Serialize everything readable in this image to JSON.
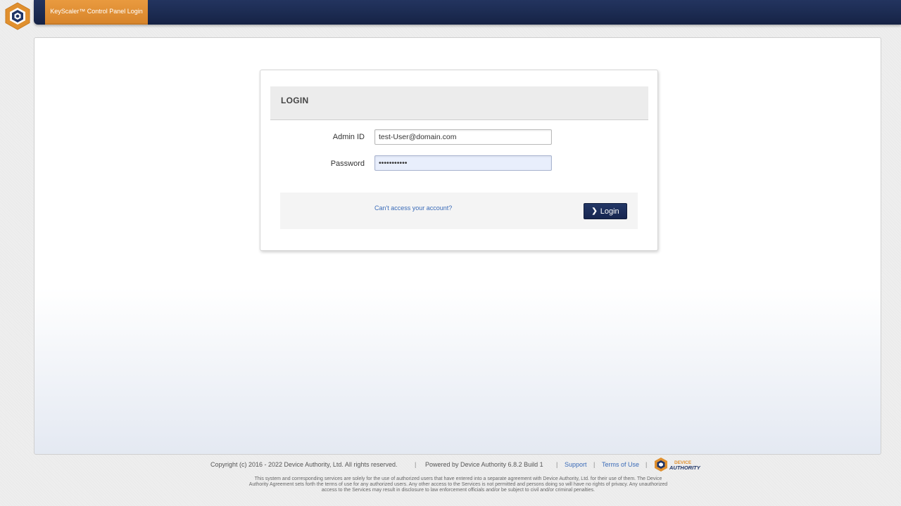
{
  "header": {
    "tab_title": "KeyScaler™ Control Panel Login",
    "brand_color": "#1b2a50",
    "tab_color": "#e0902f"
  },
  "login": {
    "title": "LOGIN",
    "admin_id_label": "Admin ID",
    "admin_id_value": "test-User@domain.com",
    "password_label": "Password",
    "password_value": "•••••••••••",
    "forgot_link": "Can't access your account?",
    "login_button": "Login",
    "login_icon": "chevron-right-icon"
  },
  "footer": {
    "copyright": "Copyright (c) 2016 - 2022 Device Authority, Ltd. All rights reserved.",
    "powered_by": "Powered by Device Authority 6.8.2 Build 1",
    "support_link": "Support",
    "terms_link": "Terms of Use",
    "separator": "|",
    "logo_text_1": "DEVICE",
    "logo_text_2": "AUTHORITY",
    "disclaimer": "This system and corresponding services are solely for the use of authorized users that have entered into a separate agreement with Device Authority, Ltd. for their use of them. The Device Authority Agreement sets forth the terms of use for any authorized users. Any other access to the Services is not permitted and persons doing so will have no rights of privacy. Any unauthorized access to the Services may result in disclosure to law enforcement officials and/or be subject to civil and/or criminal penalties."
  }
}
